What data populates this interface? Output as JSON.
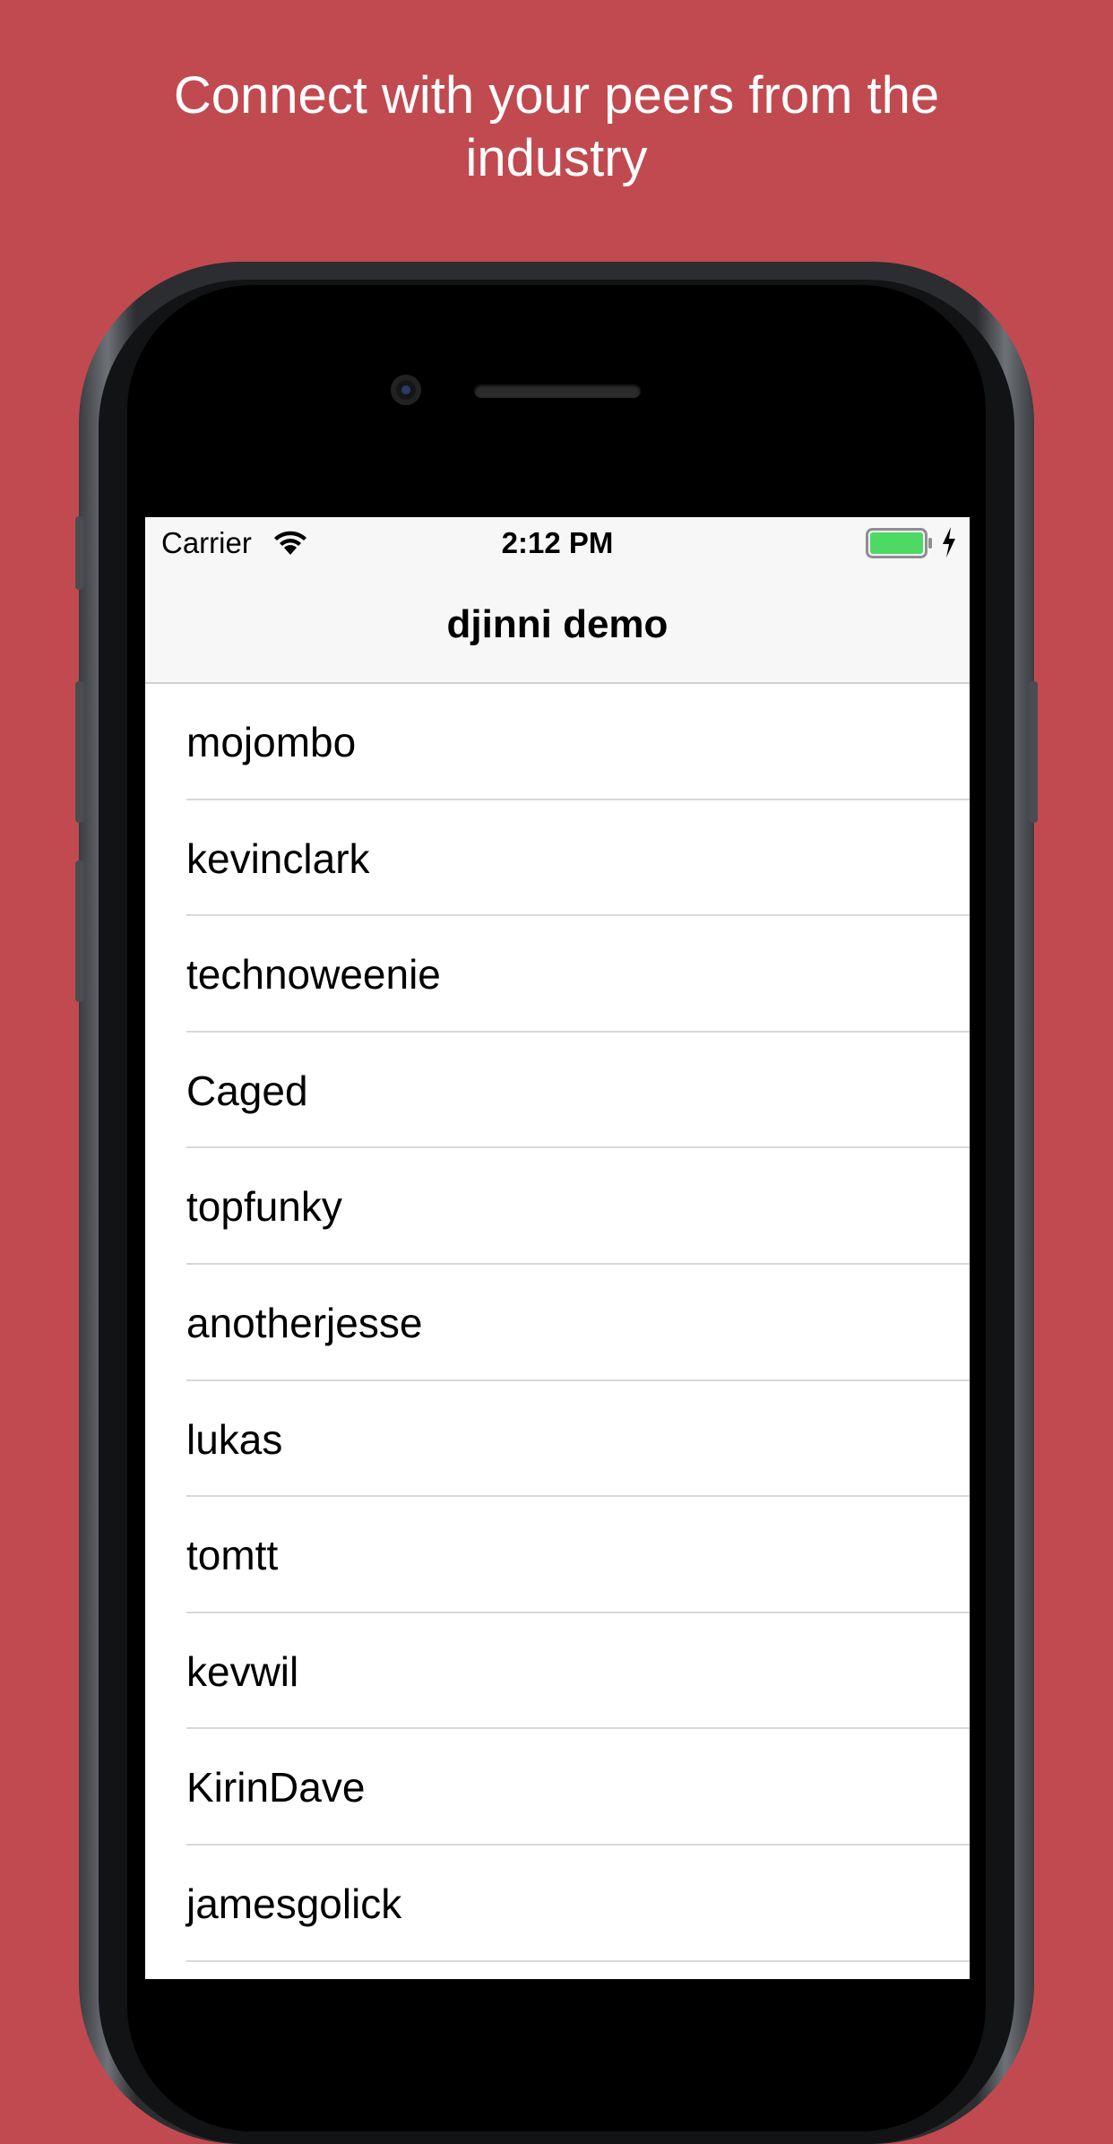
{
  "headline": {
    "line1": "Connect with your peers from the",
    "line2": "industry"
  },
  "status_bar": {
    "carrier": "Carrier",
    "time": "2:12 PM",
    "wifi_icon": "wifi-icon",
    "battery_icon": "battery-icon",
    "charging_icon": "charging-icon",
    "battery_level": 1.0,
    "battery_color": "#4cd964"
  },
  "nav": {
    "title": "djinni demo"
  },
  "users": [
    {
      "name": "mojombo"
    },
    {
      "name": "kevinclark"
    },
    {
      "name": "technoweenie"
    },
    {
      "name": "Caged"
    },
    {
      "name": "topfunky"
    },
    {
      "name": "anotherjesse"
    },
    {
      "name": "lukas"
    },
    {
      "name": "tomtt"
    },
    {
      "name": "kevwil"
    },
    {
      "name": "KirinDave"
    },
    {
      "name": "jamesgolick"
    }
  ],
  "colors": {
    "background": "#c14a50",
    "nav_bar": "#f7f7f7"
  }
}
